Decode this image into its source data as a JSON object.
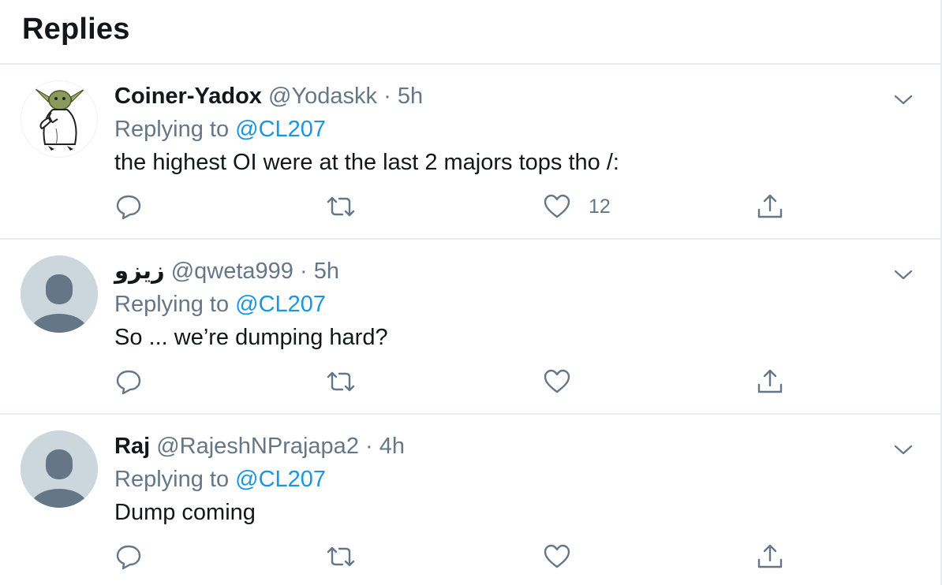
{
  "header": {
    "title": "Replies"
  },
  "colors": {
    "link": "#1b95e0",
    "muted": "#657786",
    "text": "#14171a",
    "divider": "#e6ecf0",
    "avatar_placeholder": "#ccd6dd"
  },
  "tweets": [
    {
      "display_name": "Coiner-Yadox",
      "handle": "@Yodaskk",
      "separator": "·",
      "time": "5h",
      "replying_prefix": "Replying to",
      "replying_to": "@CL207",
      "text": "the highest OI were at the last 2 majors tops tho /:",
      "like_count": "12",
      "avatar": "custom-avatar-yoda-penguin"
    },
    {
      "display_name": "زيزو",
      "handle": "@qweta999",
      "separator": "·",
      "time": "5h",
      "replying_prefix": "Replying to",
      "replying_to": "@CL207",
      "text": "So ... we’re dumping hard?",
      "like_count": "",
      "avatar": "default-avatar"
    },
    {
      "display_name": "Raj",
      "handle": "@RajeshNPrajapa2",
      "separator": "·",
      "time": "4h",
      "replying_prefix": "Replying to",
      "replying_to": "@CL207",
      "text": "Dump coming",
      "like_count": "",
      "avatar": "default-avatar"
    }
  ],
  "icons": {
    "reply": "reply-icon",
    "retweet": "retweet-icon",
    "like": "heart-icon",
    "share": "share-icon",
    "caret": "chevron-down-icon"
  }
}
